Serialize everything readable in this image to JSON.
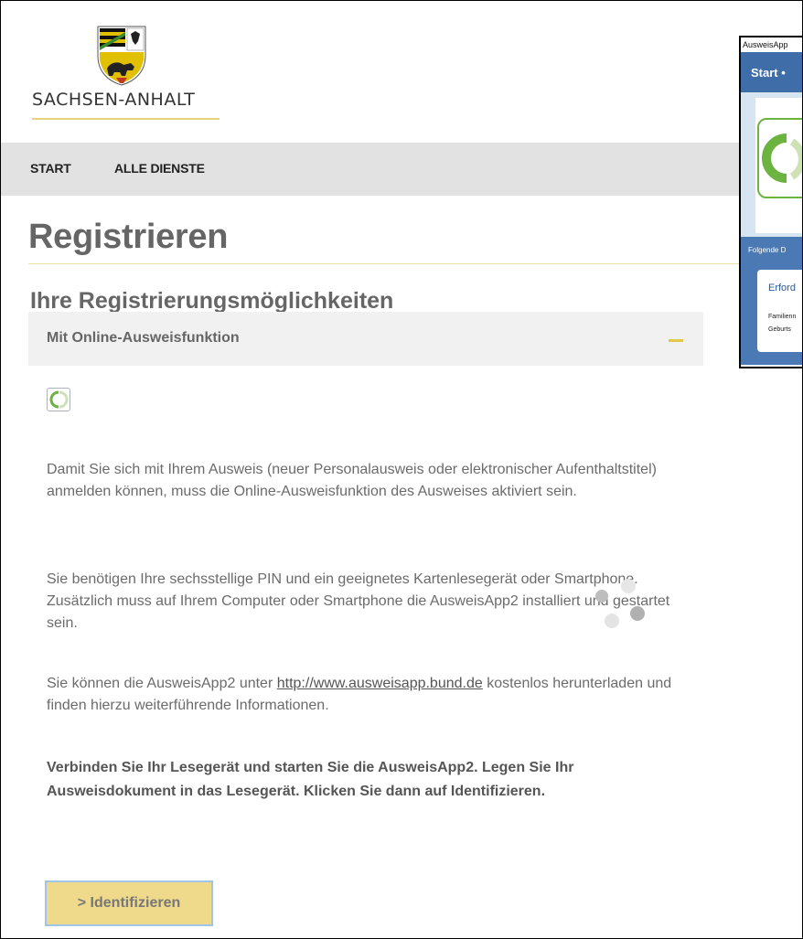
{
  "header": {
    "brand": "SACHSEN-ANHALT",
    "nav": [
      "START",
      "ALLE DIENSTE"
    ]
  },
  "main": {
    "title": "Registrieren",
    "subtitle": "Ihre Registrierungsmöglichkeiten",
    "accordion": {
      "label": "Mit Online-Ausweisfunktion",
      "toggle": "collapse",
      "paragraphs": [
        "Damit Sie sich mit Ihrem Ausweis (neuer Personalausweis oder elektronischer Aufenthaltstitel) anmelden können, muss die Online-Ausweisfunktion des Ausweises aktiviert sein.",
        "Sie benötigen Ihre sechsstellige PIN und ein geeignetes Kartenlesegerät oder Smartphone. Zusätzlich muss auf Ihrem Computer oder Smartphone die AusweisApp2 installiert und gestartet sein."
      ],
      "download_text_before": "Sie können die AusweisApp2 unter ",
      "download_link": "http://www.ausweisapp.bund.de",
      "download_text_after": " kostenlos herunterladen und finden hierzu weiterführende Informationen.",
      "instruction": "Verbinden Sie Ihr Lesegerät und starten Sie die AusweisApp2. Legen Sie Ihr Ausweisdokument in das Lesegerät. Klicken Sie dann auf Identifizieren.",
      "button": "> Identifizieren"
    }
  },
  "overlay": {
    "window_title": "AusweisApp",
    "nav": "Start •",
    "strip_text": "Folgende D",
    "card_heading": "Erford",
    "rows": [
      "Familienn",
      "Geburts"
    ]
  },
  "colors": {
    "nav_bg": "#e2e2e2",
    "accent_yellow": "#efd98a",
    "heading_gray": "#666666",
    "app_blue": "#3e6da8",
    "eid_green": "#6db33f"
  }
}
